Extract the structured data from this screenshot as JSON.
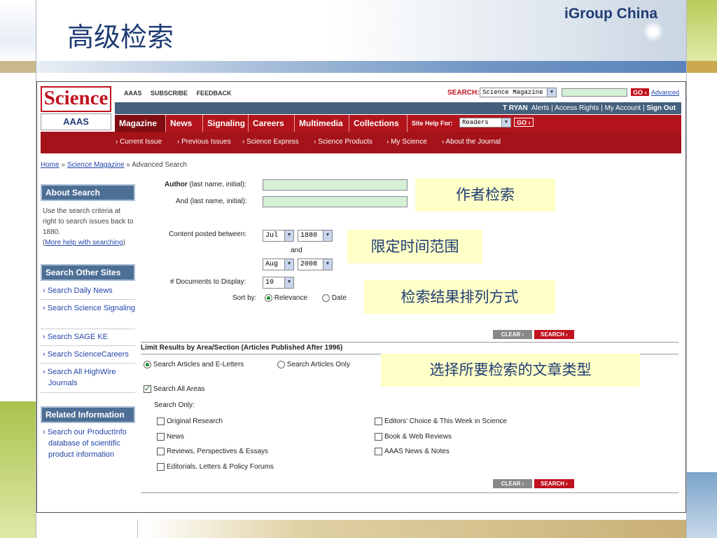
{
  "slide": {
    "title": "高级检索",
    "brand": "iGroup China"
  },
  "site": {
    "logo": "Science",
    "aaas_logo": "AAAS",
    "top_links": [
      "AAAS",
      "SUBSCRIBE",
      "FEEDBACK"
    ],
    "search_label": "SEARCH:",
    "search_scope": "Science Magazine",
    "go_label": "GO ›",
    "advanced_link": "Advanced",
    "user_bar": {
      "name": "T RYAN",
      "links": "Alerts | Access Rights | My Account |",
      "sign_out": "Sign Out"
    },
    "nav": [
      "Magazine",
      "News",
      "Signaling",
      "Careers",
      "Multimedia",
      "Collections"
    ],
    "site_help_label": "Site Help For:",
    "site_help_value": "Readers",
    "subnav": [
      "› Current Issue",
      "› Previous Issues",
      "› Science Express",
      "› Science Products",
      "› My Science",
      "› About the Journal"
    ]
  },
  "breadcrumb": {
    "home": "Home",
    "sep1": " » ",
    "magazine": "Science Magazine",
    "sep2": " » ",
    "current": "Advanced Search"
  },
  "sidebar": {
    "about_title": "About Search",
    "about_text": "Use the search criteria at right to search issues back to 1880.",
    "help_link": "More help with searching",
    "other_title": "Search Other Sites",
    "other_links": [
      "› Search Daily News",
      "› Search Science Signaling",
      "› Search SAGE KE",
      "› Search ScienceCareers",
      "› Search All HighWire Journals"
    ],
    "related_title": "Related Information",
    "related_link": "› Search our ProductInfo database of scientific product information"
  },
  "form": {
    "author_label": "Author",
    "author_hint": " (last name, initial):",
    "and_label": "And (last name, initial):",
    "posted_label": "Content posted between:",
    "from_month": "Jul",
    "from_year": "1880",
    "and_text": "and",
    "to_month": "Aug",
    "to_year": "2008",
    "docs_label": "# Documents to Display:",
    "docs_value": "10",
    "sortby_label": "Sort by:",
    "sort_relevance": "Relevance",
    "sort_date": "Date",
    "clear_label": "CLEAR ›",
    "search_label": "SEARCH ›",
    "limit_title": "Limit Results by Area/Section (Articles Published After 1996)",
    "scope_all": "Search Articles and E-Letters",
    "scope_articles": "Search Articles Only",
    "search_all_areas": "Search All Areas",
    "search_only": "Search Only:",
    "sections_left": [
      "Original Research",
      "News",
      "Reviews, Perspectives & Essays",
      "Editorials, Letters & Policy Forums"
    ],
    "sections_right": [
      "Editors' Choice & This Week in Science",
      "Book & Web Reviews",
      "AAAS News & Notes"
    ]
  },
  "annotations": {
    "author": "作者检索",
    "time": "限定时间范围",
    "sort": "检索结果排列方式",
    "type": "选择所要检索的文章类型"
  },
  "colors": {
    "science_red": "#c1121f",
    "nav_red": "#b3141c",
    "title_blue": "#1f3c74",
    "sidebar_blue": "#4d6f95"
  }
}
